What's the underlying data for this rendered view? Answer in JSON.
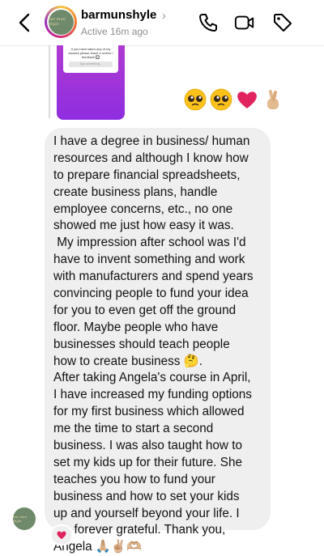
{
  "header": {
    "username": "barmunshyle",
    "chevron": "›",
    "status": "Active 16m ago",
    "avatar_text": "bar mun shyle",
    "icons": [
      "back-icon",
      "phone-icon",
      "video-camera-icon",
      "tag-icon"
    ]
  },
  "story_reply": {
    "card_text": "If you have taken any of my classes please leave a review / feedback 🔲",
    "button_text": "Type something..."
  },
  "reactions": [
    "🥹",
    "🥹",
    "❤️",
    "🤞🏼"
  ],
  "message": {
    "lines": [
      "I have a degree in business/ human",
      "resources and although I know how",
      "to prepare financial spreadsheets,",
      "create business plans, handle",
      "employee concerns, etc., no one",
      "showed me just how easy it was.",
      " My impression after school was I'd",
      "have to invent something and work",
      "with manufacturers and spend years",
      "convincing people to fund your idea",
      "for you to even get off the ground",
      "floor. Maybe people who have",
      "businesses should teach people",
      "how to create business",
      "After taking Angela's course in April,",
      "I have increased my funding options",
      "for my first business which allowed",
      "me the time to start a second",
      "business. I was also taught how to",
      "set my kids up for their future. She",
      "teaches you how to fund your",
      "business and how to set your kids",
      "up and yourself beyond your life. I",
      "am forever grateful. Thank you,",
      "Angela"
    ],
    "line14_suffix": "🤔.",
    "signoff_emojis": "🙏🏼✌🏼🫶🏼"
  },
  "reaction_pill": "❤️",
  "colors": {
    "bubble": "#efefef",
    "story_gradient_top": "#b03ad2",
    "story_gradient_bottom": "#8e2ee0",
    "heart": "#e0245e",
    "status_gray": "#8e8e8e"
  }
}
